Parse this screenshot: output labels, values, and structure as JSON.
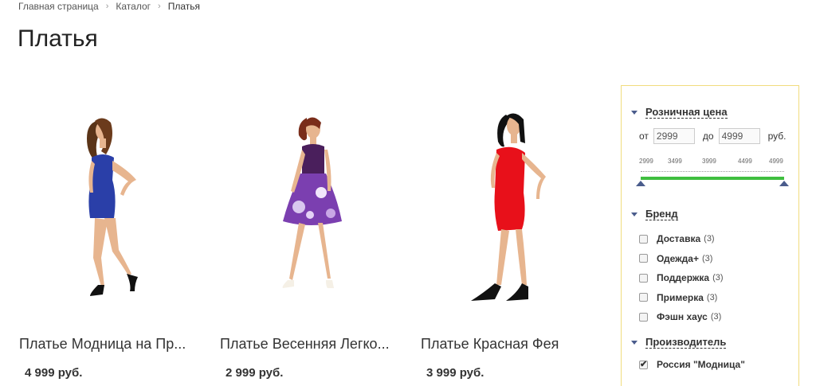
{
  "breadcrumb": {
    "home": "Главная страница",
    "catalog": "Каталог",
    "current": "Платья"
  },
  "page_title": "Платья",
  "products": [
    {
      "name": "Платье Модница на Пр...",
      "price": "4 999 руб.",
      "dress_color": "#2a3fa8"
    },
    {
      "name": "Платье Весенняя Легко...",
      "price": "2 999 руб.",
      "dress_color": "#4a1f5c"
    },
    {
      "name": "Платье Красная Фея",
      "price": "3 999 руб.",
      "dress_color": "#e8101a"
    }
  ],
  "filter": {
    "price": {
      "title": "Розничная цена",
      "from_label": "от",
      "from_value": "2999",
      "to_label": "до",
      "to_value": "4999",
      "currency": "руб.",
      "scale": [
        "2999",
        "3499",
        "3999",
        "4499",
        "4999"
      ]
    },
    "brand": {
      "title": "Бренд",
      "items": [
        {
          "label": "Доставка",
          "count": "(3)"
        },
        {
          "label": "Одежда+",
          "count": "(3)"
        },
        {
          "label": "Поддержка",
          "count": "(3)"
        },
        {
          "label": "Примерка",
          "count": "(3)"
        },
        {
          "label": "Фэшн хаус",
          "count": "(3)"
        }
      ]
    },
    "maker": {
      "title": "Производитель",
      "item": "Россия \"Модница\"",
      "checked": true
    }
  }
}
